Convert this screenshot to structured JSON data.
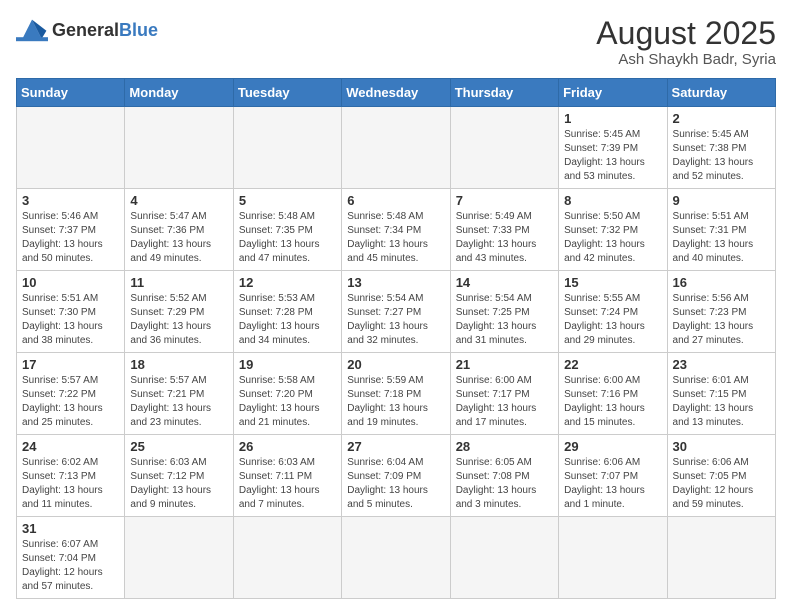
{
  "header": {
    "logo_general": "General",
    "logo_blue": "Blue",
    "month_year": "August 2025",
    "location": "Ash Shaykh Badr, Syria"
  },
  "weekdays": [
    "Sunday",
    "Monday",
    "Tuesday",
    "Wednesday",
    "Thursday",
    "Friday",
    "Saturday"
  ],
  "weeks": [
    [
      {
        "day": "",
        "info": ""
      },
      {
        "day": "",
        "info": ""
      },
      {
        "day": "",
        "info": ""
      },
      {
        "day": "",
        "info": ""
      },
      {
        "day": "",
        "info": ""
      },
      {
        "day": "1",
        "info": "Sunrise: 5:45 AM\nSunset: 7:39 PM\nDaylight: 13 hours and 53 minutes."
      },
      {
        "day": "2",
        "info": "Sunrise: 5:45 AM\nSunset: 7:38 PM\nDaylight: 13 hours and 52 minutes."
      }
    ],
    [
      {
        "day": "3",
        "info": "Sunrise: 5:46 AM\nSunset: 7:37 PM\nDaylight: 13 hours and 50 minutes."
      },
      {
        "day": "4",
        "info": "Sunrise: 5:47 AM\nSunset: 7:36 PM\nDaylight: 13 hours and 49 minutes."
      },
      {
        "day": "5",
        "info": "Sunrise: 5:48 AM\nSunset: 7:35 PM\nDaylight: 13 hours and 47 minutes."
      },
      {
        "day": "6",
        "info": "Sunrise: 5:48 AM\nSunset: 7:34 PM\nDaylight: 13 hours and 45 minutes."
      },
      {
        "day": "7",
        "info": "Sunrise: 5:49 AM\nSunset: 7:33 PM\nDaylight: 13 hours and 43 minutes."
      },
      {
        "day": "8",
        "info": "Sunrise: 5:50 AM\nSunset: 7:32 PM\nDaylight: 13 hours and 42 minutes."
      },
      {
        "day": "9",
        "info": "Sunrise: 5:51 AM\nSunset: 7:31 PM\nDaylight: 13 hours and 40 minutes."
      }
    ],
    [
      {
        "day": "10",
        "info": "Sunrise: 5:51 AM\nSunset: 7:30 PM\nDaylight: 13 hours and 38 minutes."
      },
      {
        "day": "11",
        "info": "Sunrise: 5:52 AM\nSunset: 7:29 PM\nDaylight: 13 hours and 36 minutes."
      },
      {
        "day": "12",
        "info": "Sunrise: 5:53 AM\nSunset: 7:28 PM\nDaylight: 13 hours and 34 minutes."
      },
      {
        "day": "13",
        "info": "Sunrise: 5:54 AM\nSunset: 7:27 PM\nDaylight: 13 hours and 32 minutes."
      },
      {
        "day": "14",
        "info": "Sunrise: 5:54 AM\nSunset: 7:25 PM\nDaylight: 13 hours and 31 minutes."
      },
      {
        "day": "15",
        "info": "Sunrise: 5:55 AM\nSunset: 7:24 PM\nDaylight: 13 hours and 29 minutes."
      },
      {
        "day": "16",
        "info": "Sunrise: 5:56 AM\nSunset: 7:23 PM\nDaylight: 13 hours and 27 minutes."
      }
    ],
    [
      {
        "day": "17",
        "info": "Sunrise: 5:57 AM\nSunset: 7:22 PM\nDaylight: 13 hours and 25 minutes."
      },
      {
        "day": "18",
        "info": "Sunrise: 5:57 AM\nSunset: 7:21 PM\nDaylight: 13 hours and 23 minutes."
      },
      {
        "day": "19",
        "info": "Sunrise: 5:58 AM\nSunset: 7:20 PM\nDaylight: 13 hours and 21 minutes."
      },
      {
        "day": "20",
        "info": "Sunrise: 5:59 AM\nSunset: 7:18 PM\nDaylight: 13 hours and 19 minutes."
      },
      {
        "day": "21",
        "info": "Sunrise: 6:00 AM\nSunset: 7:17 PM\nDaylight: 13 hours and 17 minutes."
      },
      {
        "day": "22",
        "info": "Sunrise: 6:00 AM\nSunset: 7:16 PM\nDaylight: 13 hours and 15 minutes."
      },
      {
        "day": "23",
        "info": "Sunrise: 6:01 AM\nSunset: 7:15 PM\nDaylight: 13 hours and 13 minutes."
      }
    ],
    [
      {
        "day": "24",
        "info": "Sunrise: 6:02 AM\nSunset: 7:13 PM\nDaylight: 13 hours and 11 minutes."
      },
      {
        "day": "25",
        "info": "Sunrise: 6:03 AM\nSunset: 7:12 PM\nDaylight: 13 hours and 9 minutes."
      },
      {
        "day": "26",
        "info": "Sunrise: 6:03 AM\nSunset: 7:11 PM\nDaylight: 13 hours and 7 minutes."
      },
      {
        "day": "27",
        "info": "Sunrise: 6:04 AM\nSunset: 7:09 PM\nDaylight: 13 hours and 5 minutes."
      },
      {
        "day": "28",
        "info": "Sunrise: 6:05 AM\nSunset: 7:08 PM\nDaylight: 13 hours and 3 minutes."
      },
      {
        "day": "29",
        "info": "Sunrise: 6:06 AM\nSunset: 7:07 PM\nDaylight: 13 hours and 1 minute."
      },
      {
        "day": "30",
        "info": "Sunrise: 6:06 AM\nSunset: 7:05 PM\nDaylight: 12 hours and 59 minutes."
      }
    ],
    [
      {
        "day": "31",
        "info": "Sunrise: 6:07 AM\nSunset: 7:04 PM\nDaylight: 12 hours and 57 minutes."
      },
      {
        "day": "",
        "info": ""
      },
      {
        "day": "",
        "info": ""
      },
      {
        "day": "",
        "info": ""
      },
      {
        "day": "",
        "info": ""
      },
      {
        "day": "",
        "info": ""
      },
      {
        "day": "",
        "info": ""
      }
    ]
  ]
}
